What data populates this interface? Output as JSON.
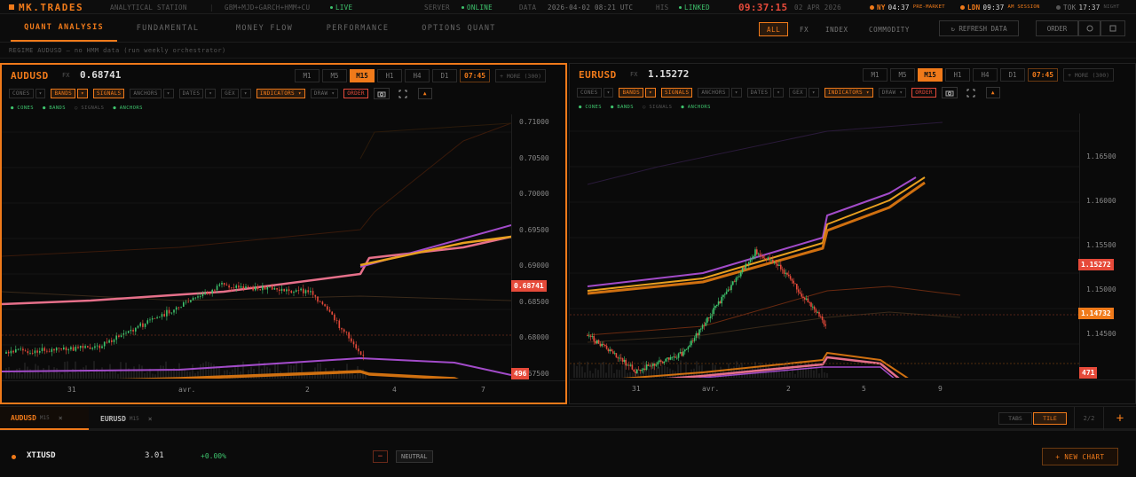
{
  "topbar": {
    "brand": "MK.TRADES",
    "subtitle": "ANALYTICAL STATION",
    "models": "GBM+MJD+GARCH+HMM+CU",
    "live": "LIVE",
    "server_label": "SERVER",
    "server_status": "ONLINE",
    "data_label": "DATA",
    "data_time": "2026-04-02 08:21 UTC",
    "hist_label": "HIS",
    "hist_status": "LINKED",
    "clock": "09:37:15",
    "date": "02 APR 2026",
    "sessions": [
      {
        "city": "NY",
        "time": "04:37",
        "status": "PRE-MARKET",
        "color": "#f07a1a"
      },
      {
        "city": "LDN",
        "time": "09:37",
        "status": "AM SESSION",
        "color": "#f07a1a"
      },
      {
        "city": "TOK",
        "time": "17:37",
        "status": "NIGHT",
        "color": "#555555"
      }
    ]
  },
  "nav": {
    "tabs": [
      "QUANT ANALYSIS",
      "FUNDAMENTAL",
      "MONEY FLOW",
      "PERFORMANCE",
      "OPTIONS QUANT"
    ],
    "filters": [
      "ALL",
      "FX",
      "INDEX",
      "COMMODITY"
    ],
    "refresh": "↻ REFRESH DATA",
    "order": "ORDER"
  },
  "regime": "REGIME  AUDUSD — no HMM data (run weekly orchestrator)",
  "charts": [
    {
      "symbol": "AUDUSD",
      "type": "FX",
      "price": "0.68741",
      "active_tf": "M15",
      "clock": "07:45",
      "more": "+ MORE (300)",
      "y_ticks": [
        "0.71000",
        "0.70500",
        "0.70000",
        "0.69500",
        "0.69000",
        "0.68500",
        "0.68000",
        "0.67500"
      ],
      "price_tag": "0.68741",
      "volume_tag": "496",
      "x_ticks": [
        "31",
        "avr.",
        "2",
        "4",
        "7"
      ]
    },
    {
      "symbol": "EURUSD",
      "type": "FX",
      "price": "1.15272",
      "active_tf": "M15",
      "clock": "07:45",
      "more": "+ MORE (300)",
      "y_ticks": [
        "1.16500",
        "1.16000",
        "1.15500",
        "1.15000",
        "1.14500"
      ],
      "price_tag": "1.15272",
      "level_tag": "1.14732",
      "volume_tag": "471",
      "x_ticks": [
        "31",
        "avr.",
        "2",
        "5",
        "9"
      ]
    }
  ],
  "timeframes": [
    "M1",
    "M5",
    "M15",
    "H1",
    "H4",
    "D1"
  ],
  "tools": {
    "cones": "CONES",
    "bands": "BANDS",
    "signals": "SIGNALS",
    "anchors": "ANCHORS",
    "dates": "DATES",
    "gex": "GEX",
    "indicators": "INDICATORS ▾",
    "draw": "DRAW ▾",
    "order": "ORDER"
  },
  "legend": [
    "● CONES",
    "● BANDS",
    "○ SIGNALS",
    "● ANCHORS"
  ],
  "bottom_tabs": [
    {
      "symbol": "AUDUSD",
      "tf": "M15"
    },
    {
      "symbol": "EURUSD",
      "tf": "M15"
    }
  ],
  "layout_controls": {
    "tabs": "TABS",
    "tile": "TILE",
    "count": "2/2",
    "add": "+"
  },
  "watchlist": {
    "symbol": "XTIUSD",
    "value": "3.01",
    "change": "+0.00%",
    "minus": "−",
    "signal": "NEUTRAL",
    "new_chart": "+ NEW CHART"
  },
  "colors": {
    "accent": "#f07a1a",
    "up": "#3ec46d",
    "down": "#e64a3a",
    "purple": "#a24bc9"
  }
}
